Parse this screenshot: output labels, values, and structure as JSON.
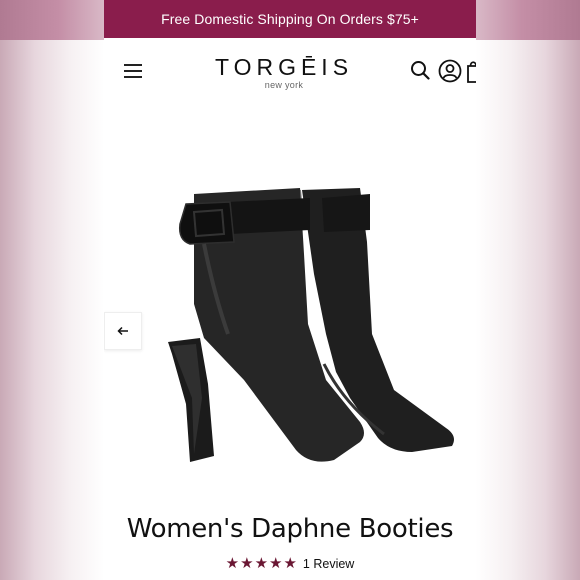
{
  "promo": {
    "text": "Free Domestic Shipping On Orders $75+"
  },
  "header": {
    "logo_main": "TORGĒIS",
    "logo_sub": "new york",
    "icons": [
      "menu-icon",
      "search-icon",
      "account-icon",
      "cart-icon"
    ]
  },
  "product": {
    "title": "Women's Daphne Booties",
    "rating": 5,
    "rating_max": 5,
    "review_text": "1 Review"
  },
  "colors": {
    "promo_bg": "#8a1d4c",
    "star": "#6a1733"
  }
}
